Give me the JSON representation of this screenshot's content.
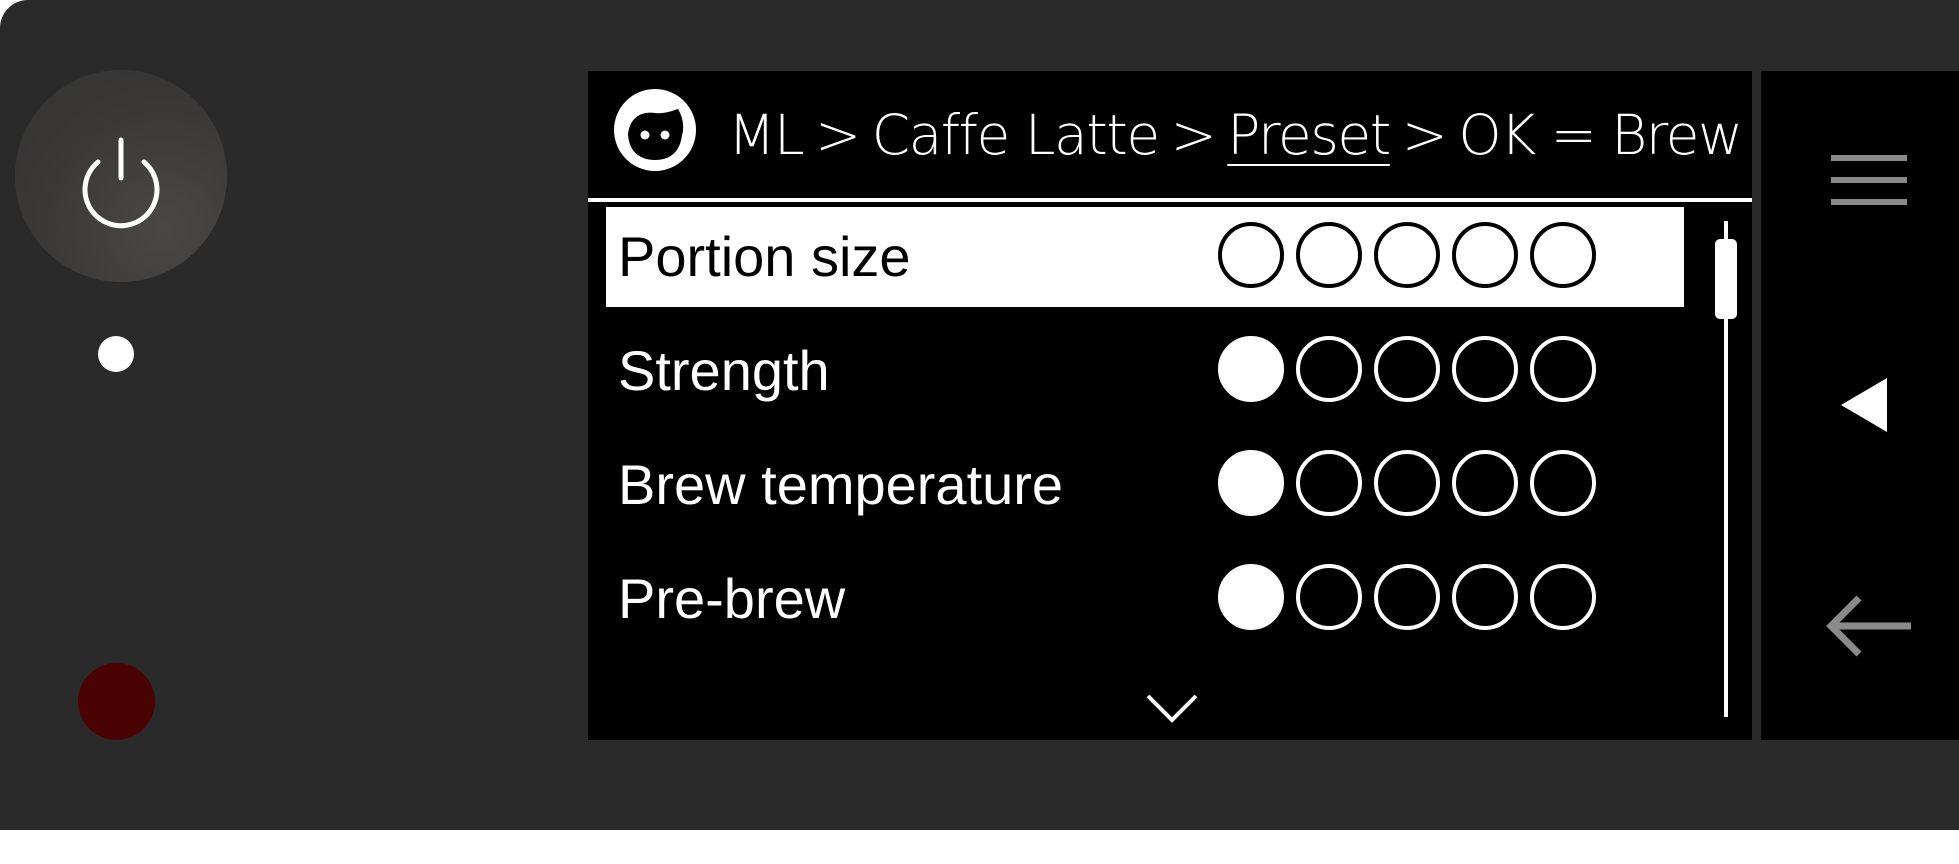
{
  "colors": {
    "panel": "#2b2a2a",
    "screen": "#000000",
    "foreground": "#ffffff",
    "red_button": "#4a0303",
    "back_arrow": "#8a8a8a"
  },
  "header": {
    "icon": "user-face-icon",
    "breadcrumb": [
      {
        "label": "ML",
        "current": false
      },
      {
        "label": "Caffe Latte",
        "current": false
      },
      {
        "label": "Preset",
        "current": true
      },
      {
        "label": "OK = Brew",
        "current": false
      }
    ],
    "separator": ">"
  },
  "settings": [
    {
      "label": "Portion size",
      "level": 0,
      "max": 5,
      "selected": true
    },
    {
      "label": "Strength",
      "level": 1,
      "max": 5,
      "selected": false
    },
    {
      "label": "Brew temperature",
      "level": 1,
      "max": 5,
      "selected": false
    },
    {
      "label": "Pre-brew",
      "level": 1,
      "max": 5,
      "selected": false
    }
  ],
  "scrollbar": {
    "position_fraction": 0.0
  },
  "more_indicator": "chevron-down-icon",
  "side_buttons": [
    {
      "icon": "menu-icon"
    },
    {
      "icon": "triangle-left-icon"
    },
    {
      "icon": "back-arrow-icon"
    }
  ]
}
